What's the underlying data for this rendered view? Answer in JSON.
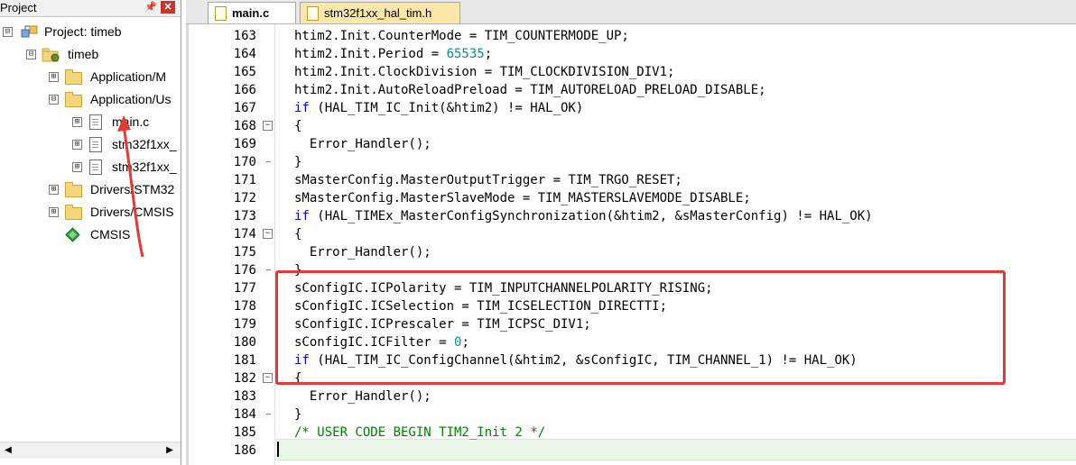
{
  "project_pane": {
    "title": "Project",
    "pin_icon": "pin-icon",
    "close_icon": "close-icon",
    "tree": [
      {
        "label": "Project: timeb",
        "icon": "project-icon"
      },
      {
        "label": "timeb",
        "icon": "target-icon"
      },
      {
        "label": "Application/M",
        "icon": "folder-icon"
      },
      {
        "label": "Application/Us",
        "icon": "folder-icon"
      },
      {
        "label": "main.c",
        "icon": "file-icon"
      },
      {
        "label": "stm32f1xx_",
        "icon": "file-icon"
      },
      {
        "label": "stm32f1xx_",
        "icon": "file-icon"
      },
      {
        "label": "Drivers/STM32",
        "icon": "folder-icon"
      },
      {
        "label": "Drivers/CMSIS",
        "icon": "folder-icon"
      },
      {
        "label": "CMSIS",
        "icon": "cmsis-gem-icon"
      }
    ],
    "expanders": {
      "minus": "⊟",
      "plus": "⊞"
    }
  },
  "tabs": [
    {
      "label": "main.c",
      "active": true
    },
    {
      "label": "stm32f1xx_hal_tim.h",
      "active": false
    }
  ],
  "code": [
    {
      "n": "163",
      "t": [
        [
          "",
          "htim2.Init.CounterMode = TIM_COUNTERMODE_UP;"
        ]
      ]
    },
    {
      "n": "164",
      "t": [
        [
          "",
          "htim2.Init.Period = "
        ],
        [
          "num",
          "65535"
        ],
        [
          "",
          ";"
        ]
      ]
    },
    {
      "n": "165",
      "t": [
        [
          "",
          "htim2.Init.ClockDivision = TIM_CLOCKDIVISION_DIV1;"
        ]
      ]
    },
    {
      "n": "166",
      "t": [
        [
          "",
          "htim2.Init.AutoReloadPreload = TIM_AUTORELOAD_PRELOAD_DISABLE;"
        ]
      ]
    },
    {
      "n": "167",
      "t": [
        [
          "kw",
          "if"
        ],
        [
          "",
          " (HAL_TIM_IC_Init(&htim2) != HAL_OK)"
        ]
      ]
    },
    {
      "n": "168",
      "fold": "open",
      "t": [
        [
          "",
          "{"
        ]
      ]
    },
    {
      "n": "169",
      "t": [
        [
          "",
          "  Error_Handler();"
        ]
      ]
    },
    {
      "n": "170",
      "fold": "end",
      "t": [
        [
          "",
          "}"
        ]
      ]
    },
    {
      "n": "171",
      "t": [
        [
          "",
          "sMasterConfig.MasterOutputTrigger = TIM_TRGO_RESET;"
        ]
      ]
    },
    {
      "n": "172",
      "t": [
        [
          "",
          "sMasterConfig.MasterSlaveMode = TIM_MASTERSLAVEMODE_DISABLE;"
        ]
      ]
    },
    {
      "n": "173",
      "t": [
        [
          "kw",
          "if"
        ],
        [
          "",
          " (HAL_TIMEx_MasterConfigSynchronization(&htim2, &sMasterConfig) != HAL_OK)"
        ]
      ]
    },
    {
      "n": "174",
      "fold": "open",
      "t": [
        [
          "",
          "{"
        ]
      ]
    },
    {
      "n": "175",
      "t": [
        [
          "",
          "  Error_Handler();"
        ]
      ]
    },
    {
      "n": "176",
      "fold": "end",
      "t": [
        [
          "",
          "}"
        ]
      ]
    },
    {
      "n": "177",
      "t": [
        [
          "",
          "sConfigIC.ICPolarity = TIM_INPUTCHANNELPOLARITY_RISING;"
        ]
      ]
    },
    {
      "n": "178",
      "t": [
        [
          "",
          "sConfigIC.ICSelection = TIM_ICSELECTION_DIRECTTI;"
        ]
      ]
    },
    {
      "n": "179",
      "t": [
        [
          "",
          "sConfigIC.ICPrescaler = TIM_ICPSC_DIV1;"
        ]
      ]
    },
    {
      "n": "180",
      "t": [
        [
          "",
          "sConfigIC.ICFilter = "
        ],
        [
          "num",
          "0"
        ],
        [
          "",
          ";"
        ]
      ]
    },
    {
      "n": "181",
      "t": [
        [
          "kw",
          "if"
        ],
        [
          "",
          " (HAL_TIM_IC_ConfigChannel(&htim2, &sConfigIC, TIM_CHANNEL_1) != HAL_OK)"
        ]
      ]
    },
    {
      "n": "182",
      "fold": "open",
      "t": [
        [
          "",
          "{"
        ]
      ]
    },
    {
      "n": "183",
      "t": [
        [
          "",
          "  Error_Handler();"
        ]
      ]
    },
    {
      "n": "184",
      "fold": "end",
      "t": [
        [
          "",
          "}"
        ]
      ]
    },
    {
      "n": "185",
      "t": [
        [
          "cmt",
          "/* USER CODE BEGIN TIM2_Init 2 */"
        ]
      ]
    },
    {
      "n": "186",
      "t": [
        [
          "",
          ""
        ]
      ]
    }
  ],
  "colors": {
    "keyword": "#0000ff",
    "number": "#009090",
    "comment": "#008000",
    "annotation": "#e53935",
    "current_line": "#eaf7e8"
  }
}
